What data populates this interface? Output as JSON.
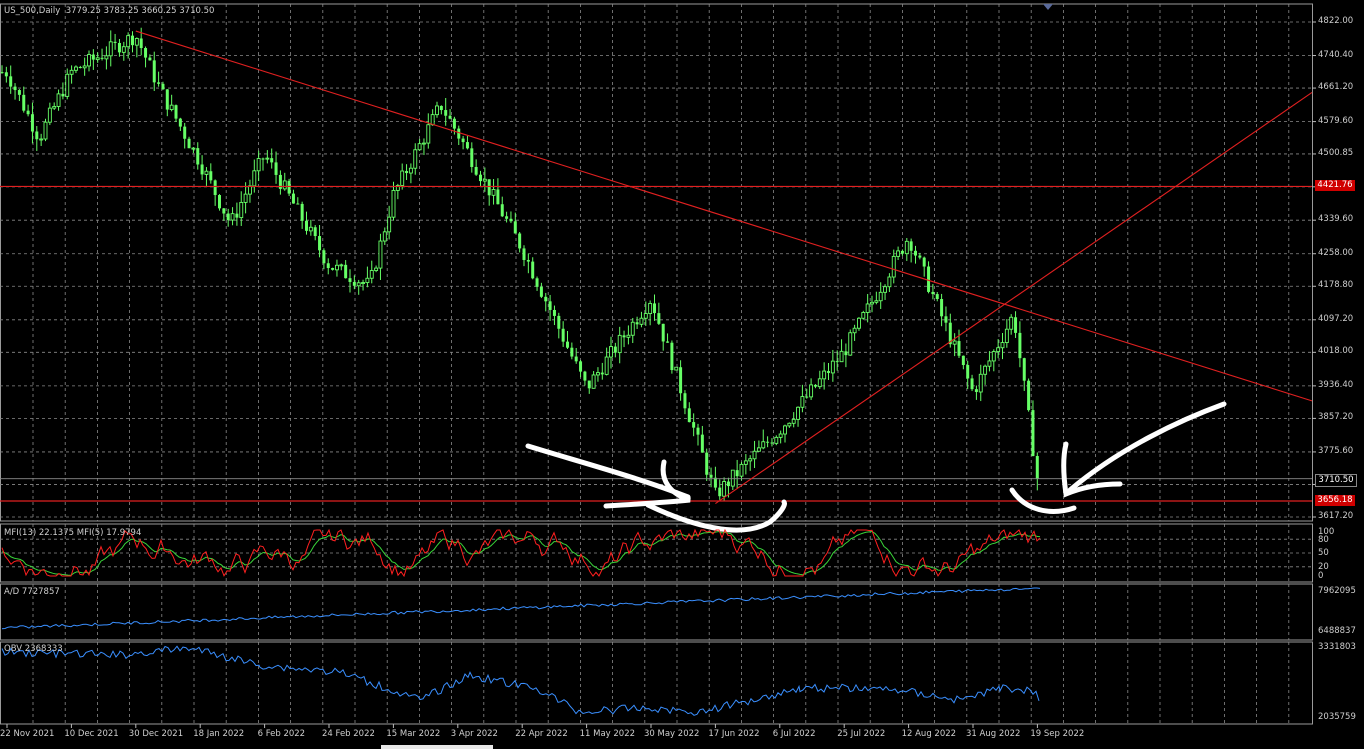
{
  "header": {
    "symbol": "US_500,Daily",
    "ohlc": "3779.25 3783.25 3660.25 3710.50"
  },
  "colors": {
    "background": "#000000",
    "candles": "#66ff66",
    "grid": "#8a8a8a",
    "trendline": "#e02020",
    "mfi_fast": "#ff2020",
    "mfi_slow": "#39d439",
    "ad_line": "#3a8fff",
    "obv_line": "#3a8fff",
    "annotation": "#ffffff"
  },
  "price_axis": {
    "ticks": [
      "4822.00",
      "4740.40",
      "4661.20",
      "4579.60",
      "4500.85",
      "4420.85",
      "4339.60",
      "4258.00",
      "4178.80",
      "4097.20",
      "4018.00",
      "3936.40",
      "3857.20",
      "3775.60",
      "3696.40",
      "3617.20"
    ],
    "current_price": "3710.50",
    "tag_upper": "4421.76",
    "tag_lower": "3656.18"
  },
  "date_axis": {
    "labels": [
      "22 Nov 2021",
      "10 Dec 2021",
      "30 Dec 2021",
      "18 Jan 2022",
      "6 Feb 2022",
      "24 Feb 2022",
      "15 Mar 2022",
      "3 Apr 2022",
      "22 Apr 2022",
      "11 May 2022",
      "30 May 2022",
      "17 Jun 2022",
      "6 Jul 2022",
      "25 Jul 2022",
      "12 Aug 2022",
      "31 Aug 2022",
      "19 Sep 2022"
    ]
  },
  "indicators": {
    "mfi": {
      "label": "MFI(13) 22.1375  MFI(5) 17.9794",
      "levels": [
        "100",
        "80",
        "50",
        "20",
        "0"
      ]
    },
    "ad": {
      "label": "A/D 7727857",
      "axis": [
        "7962095",
        "6488837"
      ]
    },
    "obv": {
      "label": "OBV 2368333",
      "axis": [
        "3331803",
        "2035759"
      ]
    }
  },
  "chart_data": {
    "type": "candlestick",
    "title": "US_500,Daily",
    "x_range": [
      "22 Nov 2021",
      "19 Sep 2022"
    ],
    "ylim": [
      3617.2,
      4822.0
    ],
    "close_path": [
      {
        "date": "22 Nov 2021",
        "close": 4700
      },
      {
        "date": "1 Dec 2021",
        "close": 4540
      },
      {
        "date": "10 Dec 2021",
        "close": 4700
      },
      {
        "date": "30 Dec 2021",
        "close": 4790
      },
      {
        "date": "6 Jan 2022",
        "close": 4660
      },
      {
        "date": "18 Jan 2022",
        "close": 4480
      },
      {
        "date": "27 Jan 2022",
        "close": 4330
      },
      {
        "date": "6 Feb 2022",
        "close": 4500
      },
      {
        "date": "24 Feb 2022",
        "close": 4230
      },
      {
        "date": "8 Mar 2022",
        "close": 4180
      },
      {
        "date": "15 Mar 2022",
        "close": 4400
      },
      {
        "date": "29 Mar 2022",
        "close": 4620
      },
      {
        "date": "3 Apr 2022",
        "close": 4550
      },
      {
        "date": "22 Apr 2022",
        "close": 4270
      },
      {
        "date": "11 May 2022",
        "close": 3930
      },
      {
        "date": "30 May 2022",
        "close": 4150
      },
      {
        "date": "17 Jun 2022",
        "close": 3670
      },
      {
        "date": "6 Jul 2022",
        "close": 3830
      },
      {
        "date": "25 Jul 2022",
        "close": 4020
      },
      {
        "date": "12 Aug 2022",
        "close": 4300
      },
      {
        "date": "31 Aug 2022",
        "close": 3920
      },
      {
        "date": "12 Sep 2022",
        "close": 4110
      },
      {
        "date": "19 Sep 2022",
        "close": 3710
      }
    ],
    "horizontal_lines": [
      4421.76,
      3656.18
    ],
    "trendlines": [
      {
        "from": {
          "date": "30 Dec 2021",
          "price": 4800
        },
        "to": {
          "date": "19 Sep 2022",
          "price": 4110
        }
      },
      {
        "from": {
          "date": "17 Jun 2022",
          "price": 3650
        },
        "to": {
          "date": "19 Sep 2022",
          "price": 4190
        }
      }
    ]
  }
}
